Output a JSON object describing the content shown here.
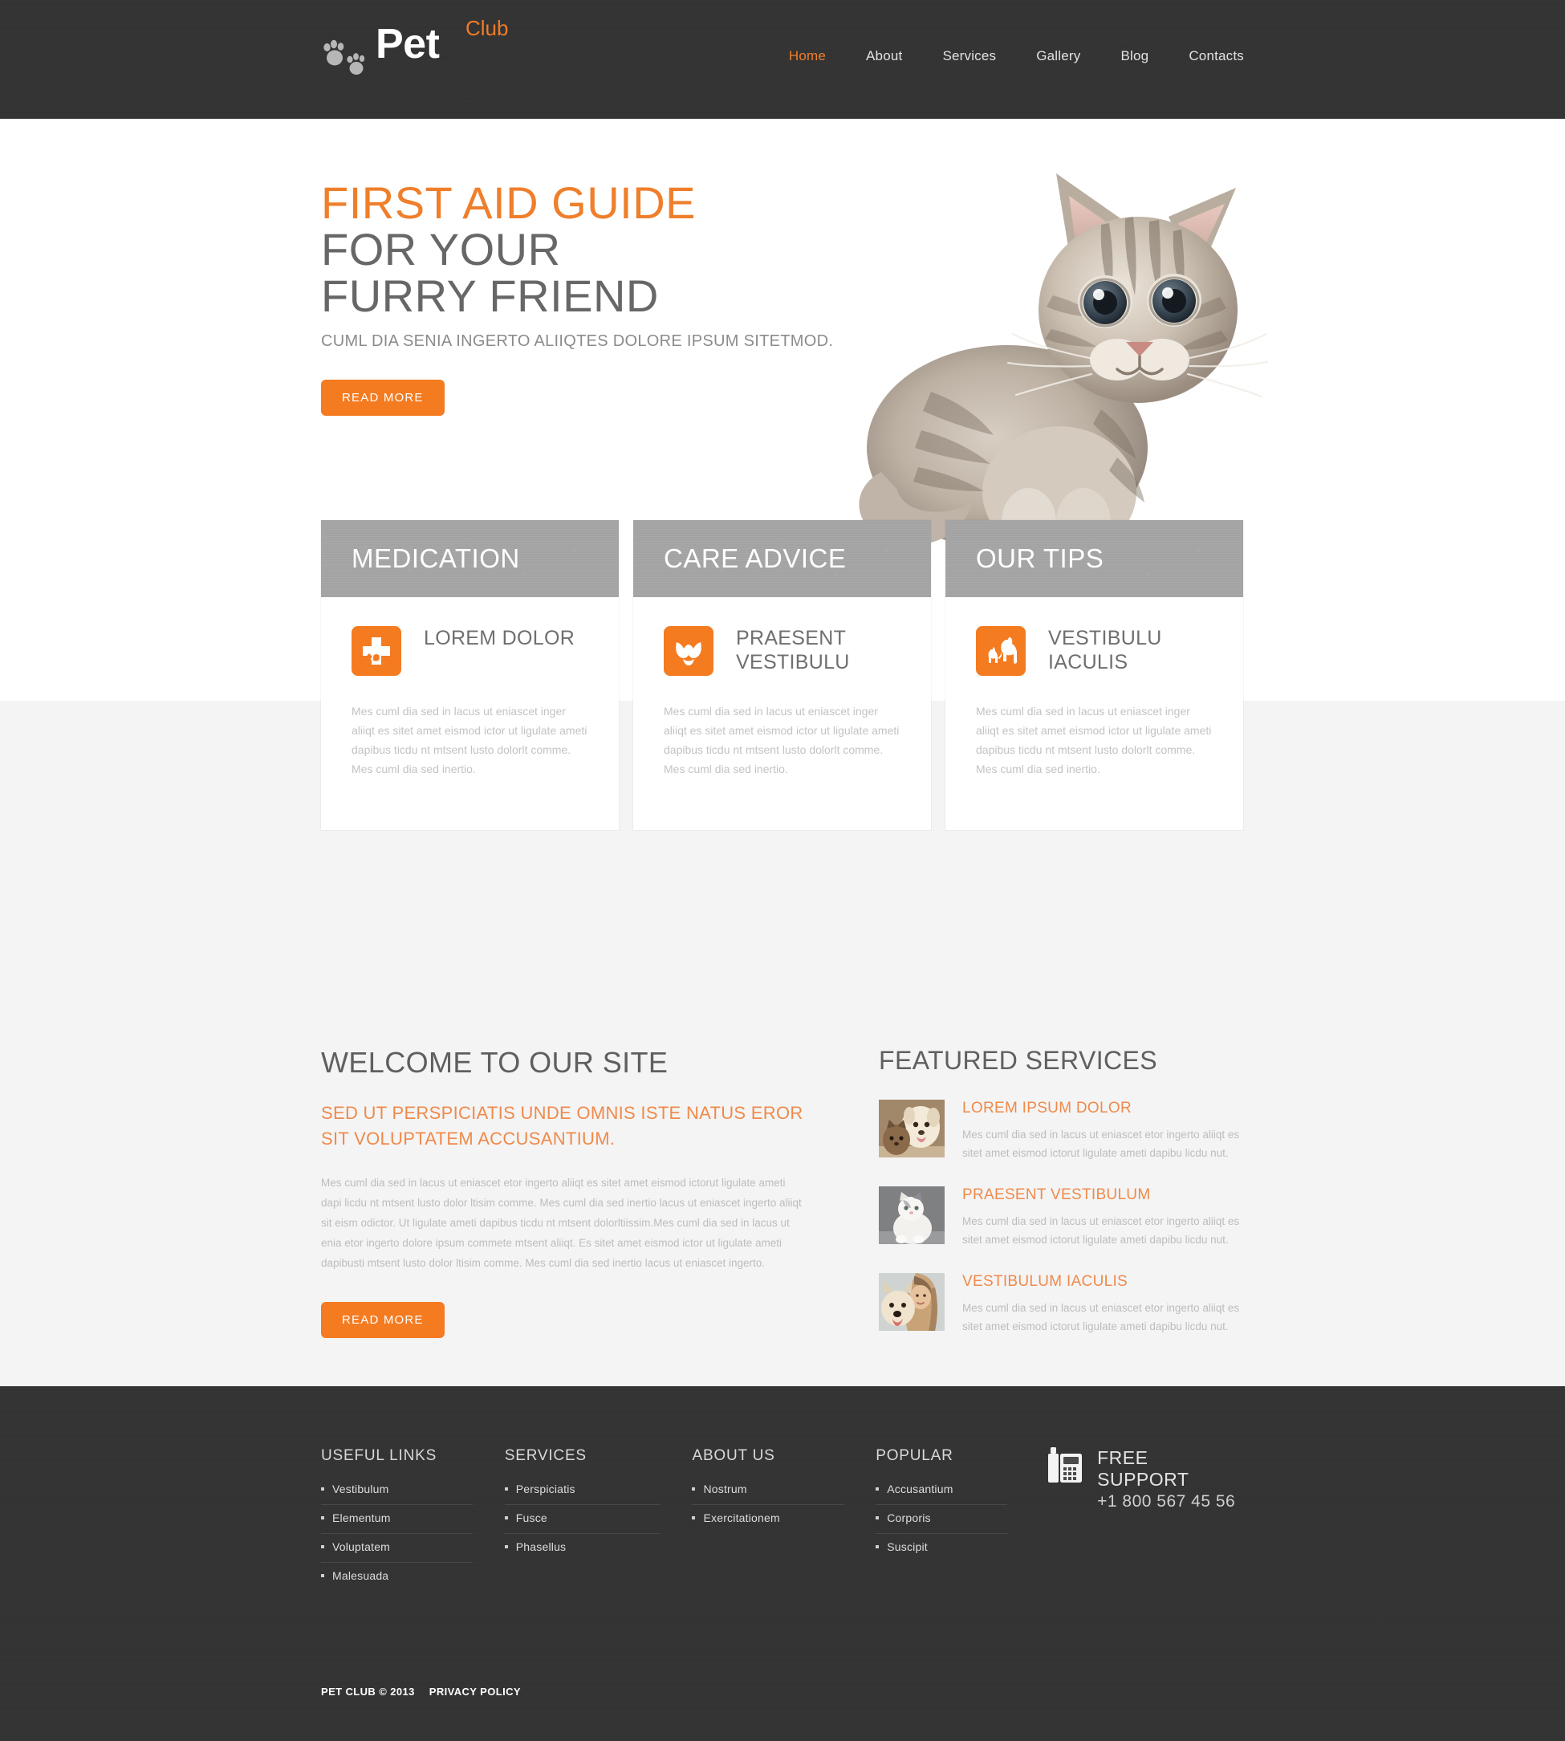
{
  "header": {
    "logo": {
      "primary": "Pet",
      "secondary": "Club",
      "icon": "paw-prints-icon"
    },
    "nav": [
      {
        "label": "Home",
        "active": true
      },
      {
        "label": "About",
        "active": false
      },
      {
        "label": "Services",
        "active": false
      },
      {
        "label": "Gallery",
        "active": false
      },
      {
        "label": "Blog",
        "active": false
      },
      {
        "label": "Contacts",
        "active": false
      }
    ]
  },
  "hero": {
    "title_accent": "FIRST AID GUIDE",
    "title_line2": "FOR YOUR",
    "title_line3": "FURRY FRIEND",
    "subtitle": "CUML DIA SENIA INGERTO ALIIQTES DOLORE IPSUM SITETMOD.",
    "cta": "READ MORE",
    "image_alt": "tabby-kitten-photo"
  },
  "cards": [
    {
      "heading": "MEDICATION",
      "icon": "veterinary-cross-icon",
      "title": "LOREM DOLOR",
      "text": "Mes cuml dia sed in lacus ut eniascet inger aliiqt es sitet amet eismod ictor ut ligulate ameti dapibus ticdu nt mtsent lusto dolorlt comme. Mes cuml dia sed inertio."
    },
    {
      "heading": "CARE ADVICE",
      "icon": "dog-face-icon",
      "title": "PRAESENT VESTIBULU",
      "text": "Mes cuml dia sed in lacus ut eniascet inger aliiqt es sitet amet eismod ictor ut ligulate ameti dapibus ticdu nt mtsent lusto dolorlt comme. Mes cuml dia sed inertio."
    },
    {
      "heading": "OUR TIPS",
      "icon": "dog-and-cat-icon",
      "title": "VESTIBULU IACULIS",
      "text": "Mes cuml dia sed in lacus ut eniascet inger aliiqt es sitet amet eismod ictor ut ligulate ameti dapibus ticdu nt mtsent lusto dolorlt comme. Mes cuml dia sed inertio."
    }
  ],
  "welcome": {
    "heading": "WELCOME TO OUR SITE",
    "subheading": "SED UT PERSPICIATIS UNDE OMNIS ISTE NATUS EROR SIT VOLUPTATEM ACCUSANTIUM.",
    "body": "Mes cuml dia sed in lacus ut eniascet etor ingerto aliiqt es sitet amet eismod ictorut ligulate ameti dapi licdu nt mtsent lusto dolor ltisim comme. Mes cuml dia sed inertio lacus ut eniascet ingerto aliiqt sit eism odictor. Ut ligulate ameti dapibus ticdu nt mtsent dolorltiissim.Mes cuml dia sed in lacus ut enia etor ingerto dolore ipsum commete mtsent aliiqt. Es sitet amet eismod ictor ut ligulate ameti dapibusti mtsent lusto dolor ltisim comme. Mes cuml dia sed inertio lacus ut eniascet ingerto.",
    "cta": "READ MORE"
  },
  "featured": {
    "heading": "FEATURED SERVICES",
    "items": [
      {
        "title": "LOREM IPSUM DOLOR",
        "text": "Mes cuml dia sed in lacus ut eniascet etor ingerto aliiqt es sitet amet eismod ictorut ligulate ameti dapibu licdu nut.",
        "thumb": "puppy-and-kitten-photo"
      },
      {
        "title": "PRAESENT VESTIBULUM",
        "text": "Mes cuml dia sed in lacus ut eniascet etor ingerto aliiqt es sitet amet eismod ictorut ligulate ameti dapibu licdu nut.",
        "thumb": "white-fluffy-cat-photo"
      },
      {
        "title": "VESTIBULUM IACULIS",
        "text": "Mes cuml dia sed in lacus ut eniascet etor ingerto aliiqt es sitet amet eismod ictorut ligulate ameti dapibu licdu nut.",
        "thumb": "woman-with-dog-photo"
      }
    ]
  },
  "footer": {
    "columns": [
      {
        "heading": "USEFUL LINKS",
        "items": [
          "Vestibulum",
          "Elementum",
          "Voluptatem",
          "Malesuada"
        ]
      },
      {
        "heading": "SERVICES",
        "items": [
          "Perspiciatis",
          "Fusce",
          "Phasellus"
        ]
      },
      {
        "heading": "ABOUT US",
        "items": [
          "Nostrum",
          "Exercitationem"
        ]
      },
      {
        "heading": "POPULAR",
        "items": [
          "Accusantium",
          "Corporis",
          "Suscipit"
        ]
      }
    ],
    "support": {
      "icon": "desk-phone-icon",
      "title": "FREE SUPPORT",
      "number": "+1 800 567 45 56"
    },
    "copyright": "PET CLUB © 2013",
    "privacy": "PRIVACY POLICY"
  },
  "colors": {
    "accent": "#f47b20",
    "accent_soft": "#ef8a4b",
    "dark": "#333333",
    "card_head": "#a3a3a3",
    "page_gray": "#f4f4f4",
    "text": "#6e6e6e",
    "muted": "#bdbdbd"
  }
}
